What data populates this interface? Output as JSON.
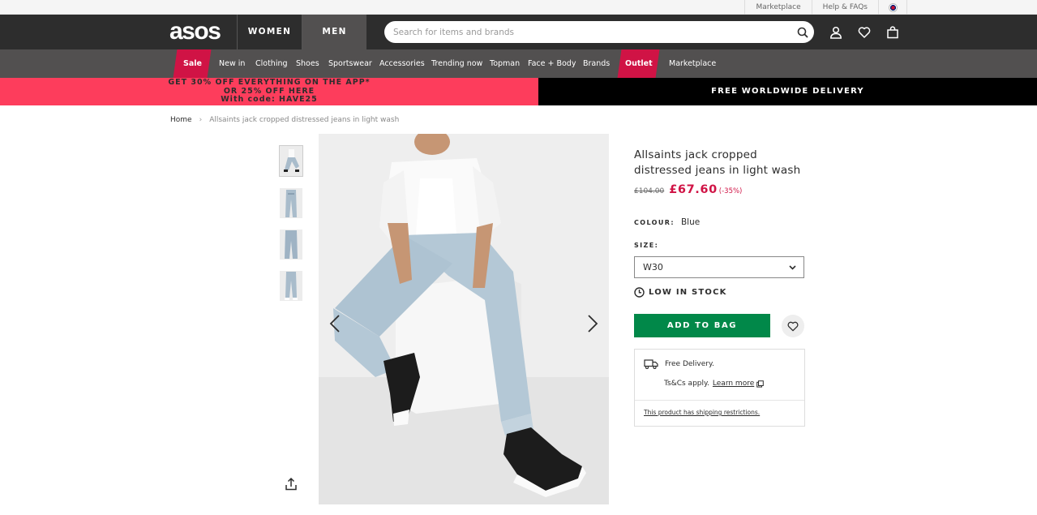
{
  "util_bar": {
    "links": [
      "Marketplace",
      "Help & FAQs"
    ],
    "country_flag": "flag-icon"
  },
  "header": {
    "logo": "asos",
    "tabs": [
      "WOMEN",
      "MEN"
    ],
    "active_tab": "MEN",
    "search_placeholder": "Search for items and brands",
    "icons": [
      "search-icon",
      "account-icon",
      "heart-icon",
      "bag-icon"
    ]
  },
  "nav": {
    "items": [
      "Sale",
      "New in",
      "Clothing",
      "Shoes",
      "Sportswear",
      "Accessories",
      "Trending now",
      "Topman",
      "Face + Body",
      "Brands",
      "Outlet",
      "Marketplace"
    ],
    "highlighted": [
      "Sale",
      "Outlet"
    ]
  },
  "promo": {
    "left_line1": "GET 30% OFF EVERYTHING ON THE APP*",
    "left_line2": "OR 25% OFF HERE",
    "left_line3": "With code: HAVE25",
    "right": "FREE WORLDWIDE DELIVERY"
  },
  "breadcrumb": {
    "home": "Home",
    "separator": "›",
    "current": "Allsaints jack cropped distressed jeans in light wash"
  },
  "product": {
    "title": "Allsaints jack cropped distressed jeans in light wash",
    "old_price": "£104.00",
    "price": "£67.60",
    "discount": "(-35%)",
    "colour_label": "COLOUR:",
    "colour": "Blue",
    "size_label": "SIZE:",
    "size": "W30",
    "stock": "LOW IN STOCK",
    "add_to_bag": "ADD TO BAG"
  },
  "delivery": {
    "free": "Free Delivery.",
    "tcs": "Ts&Cs apply.",
    "learn_more": "Learn more",
    "restriction": "This product has shipping restrictions."
  },
  "colors": {
    "header": "#2d2d2d",
    "nav": "#525050",
    "sale": "#d01345",
    "promo_left": "#fd3d5c",
    "add_button": "#018849"
  }
}
